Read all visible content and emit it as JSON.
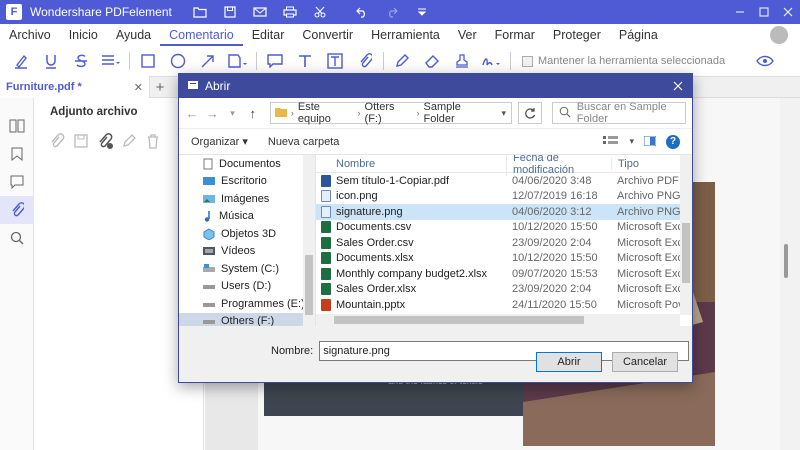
{
  "app": {
    "title": "Wondershare PDFelement",
    "logo_letter": "F"
  },
  "menu": [
    "Archivo",
    "Inicio",
    "Ayuda",
    "Comentario",
    "Editar",
    "Convertir",
    "Herramienta",
    "Ver",
    "Formar",
    "Proteger",
    "Página"
  ],
  "menu_active": "Comentario",
  "toolbar": {
    "keep_tool_label": "Mantener la herramienta seleccionada"
  },
  "tab": {
    "label": "Furniture.pdf *",
    "add": "+"
  },
  "attachments": {
    "title": "Adjunto archivo"
  },
  "document": {
    "caption": "and the fabrics of textile"
  },
  "dialog": {
    "title": "Abrir",
    "breadcrumb": [
      "Este equipo",
      "Otters (F:)",
      "Sample Folder"
    ],
    "search_placeholder": "Buscar en Sample Folder",
    "organize": "Organizar",
    "new_folder": "Nueva carpeta",
    "nav": [
      "Documentos",
      "Escritorio",
      "Imágenes",
      "Música",
      "Objetos 3D",
      "Vídeos",
      "System (C:)",
      "Users (D:)",
      "Programmes (E:)",
      "Others (F:)"
    ],
    "columns": {
      "name": "Nombre",
      "date": "Fecha de modificación",
      "type": "Tipo"
    },
    "files": [
      {
        "name": "Sem título-1-Copiar.pdf",
        "date": "04/06/2020 3:48",
        "type": "Archivo PDF",
        "kind": "pdf"
      },
      {
        "name": "icon.png",
        "date": "12/07/2019 16:18",
        "type": "Archivo PNG",
        "kind": "png"
      },
      {
        "name": "signature.png",
        "date": "04/06/2020 3:12",
        "type": "Archivo PNG",
        "kind": "png"
      },
      {
        "name": "Documents.csv",
        "date": "10/12/2020 15:50",
        "type": "Microsoft Exc",
        "kind": "xls"
      },
      {
        "name": "Sales Order.csv",
        "date": "23/09/2020 2:04",
        "type": "Microsoft Exc",
        "kind": "xls"
      },
      {
        "name": "Documents.xlsx",
        "date": "10/12/2020 15:50",
        "type": "Microsoft Exc",
        "kind": "xls"
      },
      {
        "name": "Monthly company budget2.xlsx",
        "date": "09/07/2020 15:53",
        "type": "Microsoft Exc",
        "kind": "xls"
      },
      {
        "name": "Sales Order.xlsx",
        "date": "23/09/2020 2:04",
        "type": "Microsoft Exc",
        "kind": "xls"
      },
      {
        "name": "Mountain.pptx",
        "date": "24/11/2020 15:50",
        "type": "Microsoft Pov",
        "kind": "ppt"
      }
    ],
    "filename_label": "Nombre:",
    "filename_value": "signature.png",
    "open_button": "Abrir",
    "cancel_button": "Cancelar"
  },
  "colors": {
    "accent": "#4f5bd5",
    "dialog_title": "#3e4b9c",
    "selection": "#cce4f7"
  }
}
